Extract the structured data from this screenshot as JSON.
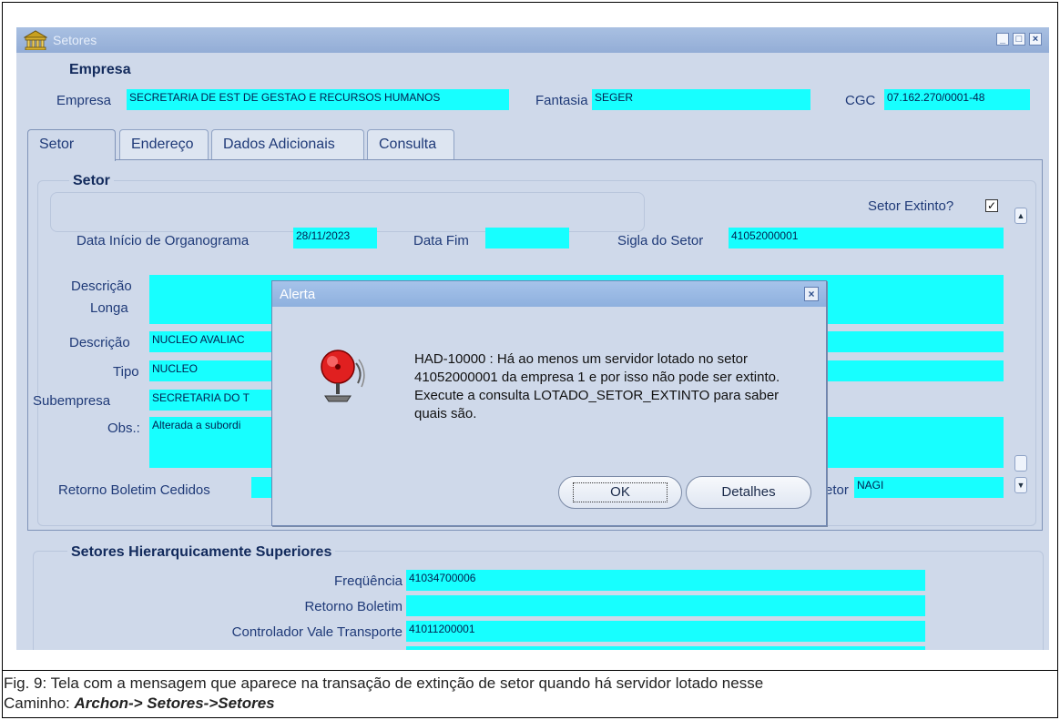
{
  "window": {
    "title": "Setores"
  },
  "empresa": {
    "section_label": "Empresa",
    "empresa_label": "Empresa",
    "empresa_value": "SECRETARIA DE EST DE GESTAO E RECURSOS HUMANOS",
    "fantasia_label": "Fantasia",
    "fantasia_value": "SEGER",
    "cgc_label": "CGC",
    "cgc_value": "07.162.270/0001-48"
  },
  "tabs": [
    "Setor",
    "Endereço",
    "Dados Adicionais",
    "Consulta"
  ],
  "setor": {
    "section_label": "Setor",
    "extinto_label": "Setor Extinto?",
    "extinto_checked": "✓",
    "data_inicio_label": "Data Início de Organograma",
    "data_inicio_value": "28/11/2023",
    "data_fim_label": "Data Fim",
    "data_fim_value": "",
    "sigla_label": "Sigla do Setor",
    "sigla_value": "41052000001",
    "descricao_longa_label_1": "Descrição",
    "descricao_longa_label_2": "Longa",
    "descricao_label": "Descrição",
    "descricao_value": "NUCLEO AVALIAC",
    "tipo_label": "Tipo",
    "tipo_value": "NUCLEO",
    "subempresa_label": "Subempresa",
    "subempresa_value": "SECRETARIA DO T",
    "obs_label": "Obs.:",
    "obs_value": "Alterada a subordi",
    "retorno_label": "Retorno Boletim Cedidos",
    "setor_label_partial": "etor",
    "setor_value": "NAGI"
  },
  "hierarquia": {
    "section_label": "Setores Hierarquicamente Superiores",
    "frequencia_label": "Freqüência",
    "frequencia_value": "41034700006",
    "retorno_label": "Retorno Boletim",
    "retorno_value": "",
    "controlador_label": "Controlador Vale Transporte",
    "controlador_value": "41011200001"
  },
  "dialog": {
    "title": "Alerta",
    "message": "HAD-10000 : Há ao menos um servidor lotado no setor 41052000001 da empresa 1 e por isso não pode ser extinto. Execute a consulta LOTADO_SETOR_EXTINTO para saber quais são.",
    "ok_label": "OK",
    "details_label": "Detalhes"
  },
  "caption": {
    "line1": "Fig. 9: Tela com a mensagem que aparece na transação de extinção de setor quando há servidor lotado nesse",
    "line2_prefix": "Caminho: ",
    "line2_path": "Archon-> Setores->Setores"
  }
}
